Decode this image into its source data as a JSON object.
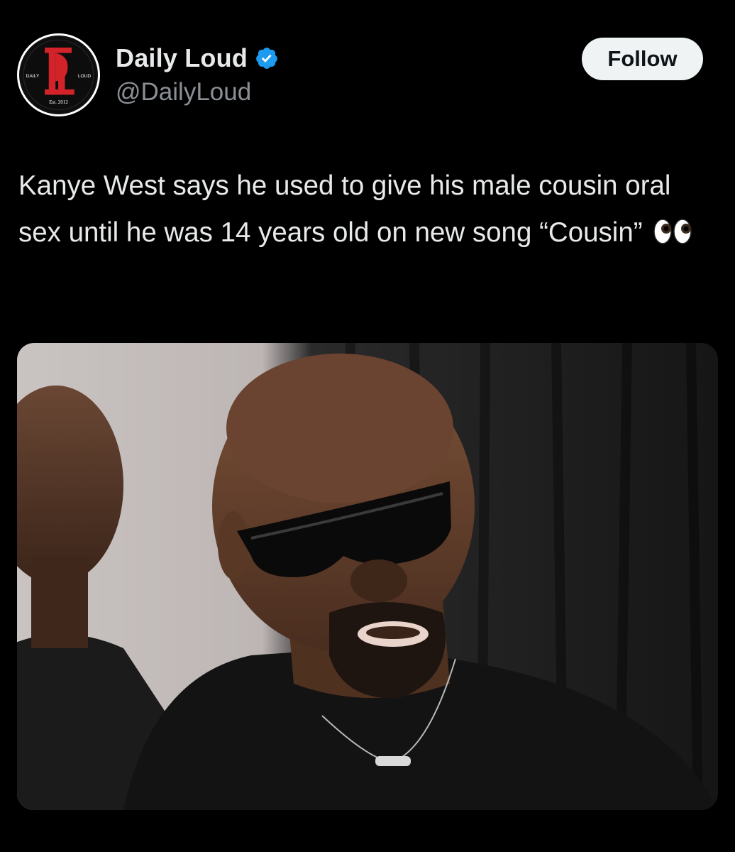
{
  "post": {
    "author": {
      "display_name": "Daily Loud",
      "handle": "@DailyLoud",
      "verified": true,
      "verified_icon": "verified-badge-icon",
      "avatar": {
        "initials": "DL",
        "left_text": "DAILY",
        "right_text": "LOUD",
        "bottom_text": "Est. 2012"
      }
    },
    "follow_label": "Follow",
    "text": "Kanye West says he used to give his male cousin oral sex until he was 14 years old on new song “Cousin”",
    "emoji": "eyes-emoji",
    "media": {
      "type": "photo",
      "icon": "photo-icon"
    }
  },
  "colors": {
    "background": "#000000",
    "text": "#e7e9ea",
    "secondary_text": "#8b9096",
    "verified_blue": "#1d9bf0",
    "follow_bg": "#eff3f4",
    "logo_red": "#d2232a"
  }
}
